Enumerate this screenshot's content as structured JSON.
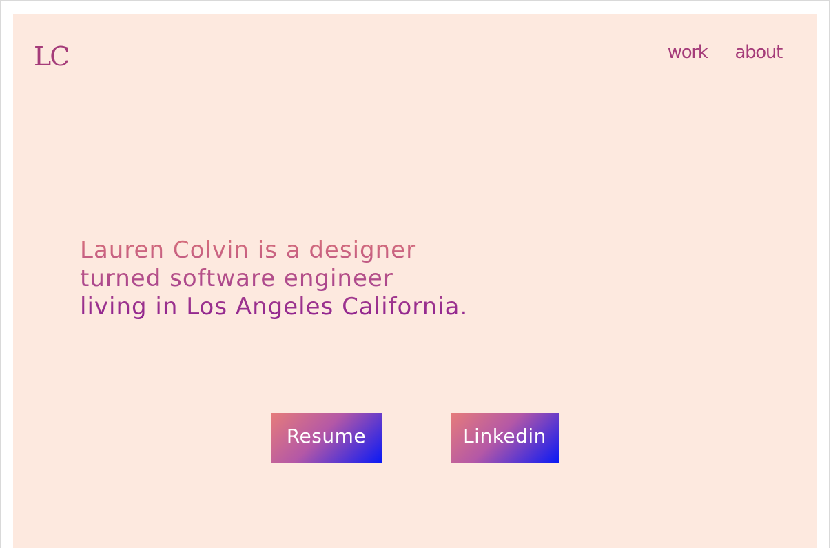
{
  "header": {
    "logo": "LC",
    "nav": [
      {
        "label": "work"
      },
      {
        "label": "about"
      }
    ]
  },
  "hero": {
    "lines": [
      "Lauren Colvin is a designer",
      "turned software engineer",
      "living in Los Angeles California."
    ]
  },
  "actions": {
    "resume_label": "Resume",
    "linkedin_label": "Linkedin"
  },
  "colors": {
    "background": "#fde9df",
    "accent": "#a53c7a",
    "button_gradient_start": "#e67c7a",
    "button_gradient_end": "#0a1af5"
  }
}
